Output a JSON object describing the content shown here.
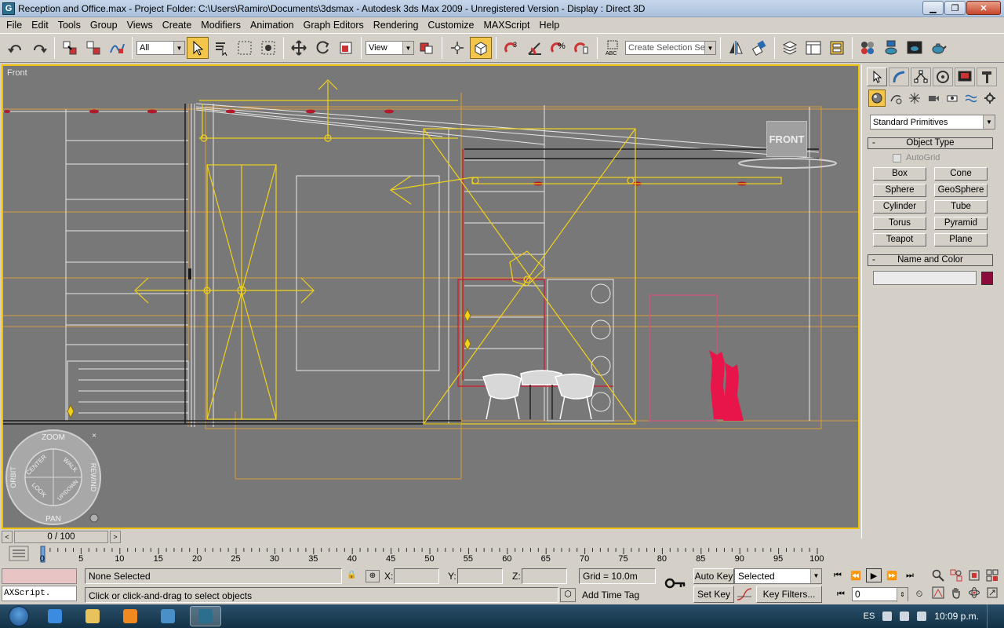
{
  "window": {
    "title": "Reception and Office.max     - Project Folder: C:\\Users\\Ramiro\\Documents\\3dsmax     - Autodesk 3ds Max  2009    - Unregistered Version     - Display : Direct 3D",
    "app_icon": "G",
    "minimize": "▁",
    "maximize": "❐",
    "close": "✕"
  },
  "menu": [
    "File",
    "Edit",
    "Tools",
    "Group",
    "Views",
    "Create",
    "Modifiers",
    "Animation",
    "Graph Editors",
    "Rendering",
    "Customize",
    "MAXScript",
    "Help"
  ],
  "toolbar": {
    "selection_filter": "All",
    "ref_coord": "View",
    "selection_set_placeholder": "Create Selection Set",
    "snap_label": "3",
    "angle_snap_label": "%",
    "abc_label": "ABC"
  },
  "viewport": {
    "label": "Front",
    "viewcube_label": "FRONT",
    "steering": {
      "zoom": "ZOOM",
      "orbit": "ORBIT",
      "rewind": "REWIND",
      "pan": "PAN",
      "center": "CENTER",
      "walk": "WALK",
      "look": "LOOK",
      "updown": "UP/DOWN"
    },
    "accent_color": "#f1c00a"
  },
  "command_panel": {
    "category": "Standard Primitives",
    "object_type_title": "Object Type",
    "autogrid": "AutoGrid",
    "primitives": [
      "Box",
      "Cone",
      "Sphere",
      "GeoSphere",
      "Cylinder",
      "Tube",
      "Torus",
      "Pyramid",
      "Teapot",
      "Plane"
    ],
    "name_color_title": "Name and Color",
    "name_value": "",
    "object_color": "#8b0b3a"
  },
  "time_slider": {
    "position": "0 / 100",
    "prev": "<",
    "next": ">"
  },
  "trackbar": {
    "ticks": [
      "0",
      "5",
      "10",
      "15",
      "20",
      "25",
      "30",
      "35",
      "40",
      "45",
      "50",
      "55",
      "60",
      "65",
      "70",
      "75",
      "80",
      "85",
      "90",
      "95",
      "100"
    ]
  },
  "status": {
    "maxscript_label": "AXScript.",
    "selection": "None Selected",
    "prompt": "Click or click-and-drag to select objects",
    "x_label": "X:",
    "y_label": "Y:",
    "z_label": "Z:",
    "x_value": "",
    "y_value": "",
    "z_value": "",
    "grid": "Grid = 10.0m",
    "add_time_tag": "Add Time Tag",
    "auto_key": "Auto Key",
    "set_key": "Set Key",
    "key_mode": "Selected",
    "key_filters": "Key Filters...",
    "current_frame": "0"
  },
  "taskbar": {
    "language": "ES",
    "clock": "10:09 p.m."
  }
}
